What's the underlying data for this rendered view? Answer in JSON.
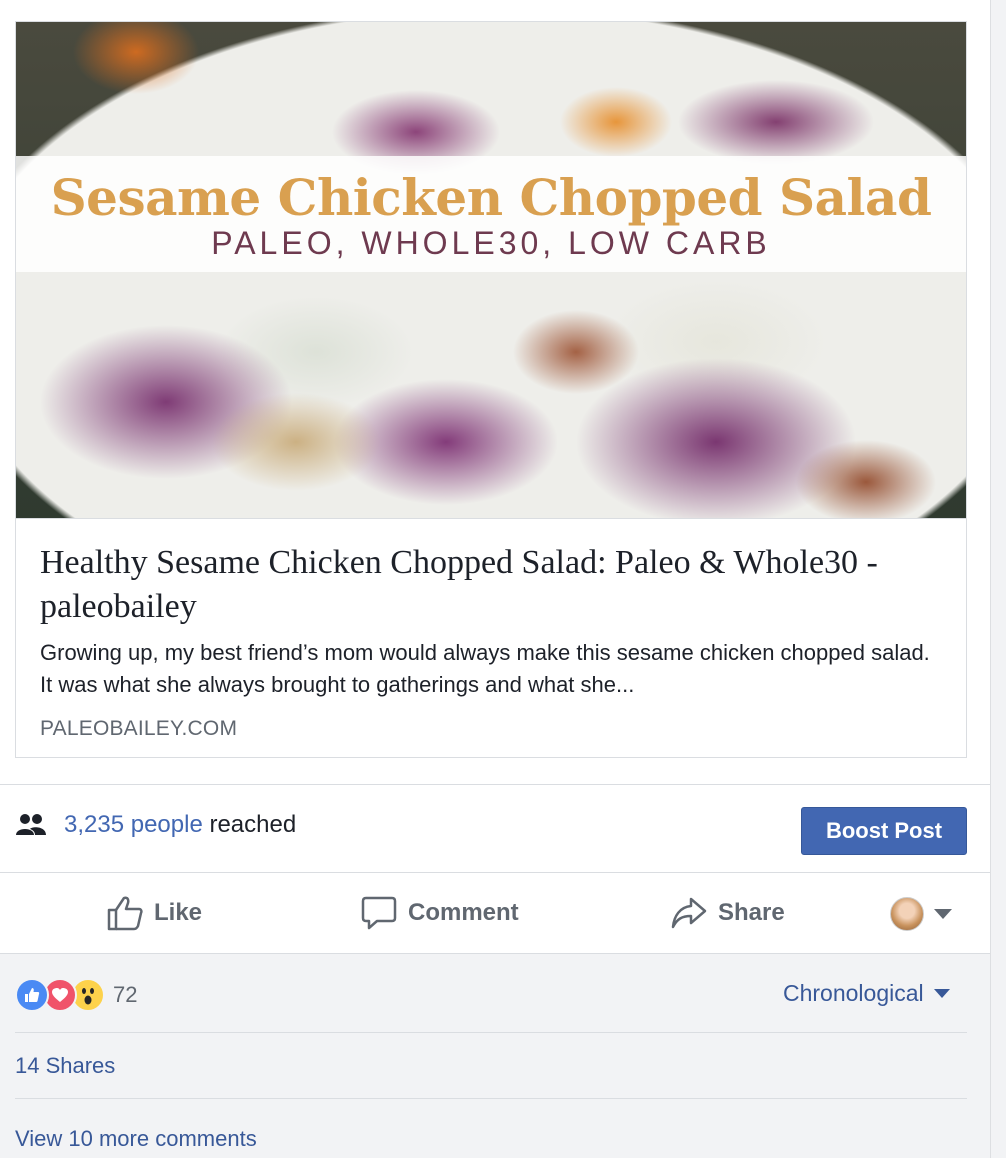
{
  "link_preview": {
    "image_title": "Sesame Chicken Chopped Salad",
    "image_subtitle": "PALEO, WHOLE30, LOW CARB",
    "title": "Healthy Sesame Chicken Chopped Salad: Paleo & Whole30 - paleobailey",
    "description": "Growing up, my best friend’s mom would always make this sesame chicken chopped salad. It was what she always brought to gatherings and what she...",
    "domain": "PALEOBAILEY.COM"
  },
  "insights": {
    "reach_icon": "people-icon",
    "reach_count": "3,235 people",
    "reach_suffix": " reached",
    "boost_label": "Boost Post"
  },
  "actions": {
    "like_label": "Like",
    "comment_label": "Comment",
    "share_label": "Share",
    "avatar_icon": "profile-avatar",
    "caret_icon": "caret-down-icon"
  },
  "feedback": {
    "reaction_icons": [
      "like-reaction-icon",
      "love-reaction-icon",
      "wow-reaction-icon"
    ],
    "reaction_count": "72",
    "sort_label": "Chronological",
    "shares_label": "14 Shares",
    "more_comments_label": "View 10 more comments"
  },
  "colors": {
    "link_blue": "#4267b2",
    "text_blue": "#385898",
    "grey_text": "#606770",
    "banner_gold": "#d9a050",
    "banner_plum": "#6e3a4f"
  }
}
